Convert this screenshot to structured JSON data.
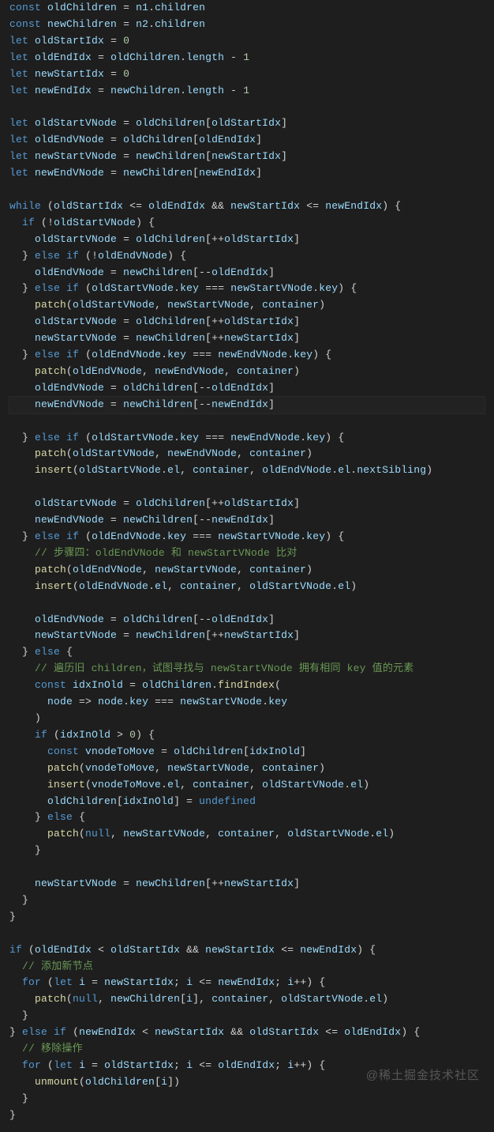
{
  "watermark": "@稀土掘金技术社区",
  "tokens": {
    "kw_const": "const",
    "kw_let": "let",
    "kw_while": "while",
    "kw_if": "if",
    "kw_else": "else",
    "kw_for": "for",
    "kw_null": "null",
    "kw_undefined": "undefined"
  },
  "code_model": {
    "description": "double-ended diff algorithm (Vue-style)",
    "identifiers": [
      "oldChildren",
      "newChildren",
      "oldStartIdx",
      "oldEndIdx",
      "newStartIdx",
      "newEndIdx",
      "oldStartVNode",
      "oldEndVNode",
      "newStartVNode",
      "newEndVNode",
      "n1",
      "n2",
      "children",
      "length",
      "key",
      "el",
      "nextSibling",
      "patch",
      "insert",
      "unmount",
      "container",
      "idxInOld",
      "vnodeToMove",
      "findIndex",
      "node",
      "i"
    ],
    "numeric_literals": [
      0,
      1
    ],
    "comments": [
      "// 步骤四：oldEndVNode 和 newStartVNode 比对",
      "// 遍历旧 children，试图寻找与 newStartVNode 拥有相同 key 值的元素",
      "// 添加新节点",
      "// 移除操作"
    ]
  },
  "chart_data": null,
  "code_lines": [
    "const oldChildren = n1.children",
    "const newChildren = n2.children",
    "let oldStartIdx = 0",
    "let oldEndIdx = oldChildren.length - 1",
    "let newStartIdx = 0",
    "let newEndIdx = newChildren.length - 1",
    "",
    "let oldStartVNode = oldChildren[oldStartIdx]",
    "let oldEndVNode = oldChildren[oldEndIdx]",
    "let newStartVNode = newChildren[newStartIdx]",
    "let newEndVNode = newChildren[newEndIdx]",
    "",
    "while (oldStartIdx <= oldEndIdx && newStartIdx <= newEndIdx) {",
    "  if (!oldStartVNode) {",
    "    oldStartVNode = oldChildren[++oldStartIdx]",
    "  } else if (!oldEndVNode) {",
    "    oldEndVNode = newChildren[--oldEndIdx]",
    "  } else if (oldStartVNode.key === newStartVNode.key) {",
    "    patch(oldStartVNode, newStartVNode, container)",
    "    oldStartVNode = oldChildren[++oldStartIdx]",
    "    newStartVNode = newChildren[++newStartIdx]",
    "  } else if (oldEndVNode.key === newEndVNode.key) {",
    "    patch(oldEndVNode, newEndVNode, container)",
    "    oldEndVNode = oldChildren[--oldEndIdx]",
    "    newEndVNode = newChildren[--newEndIdx]",
    "  } else if (oldStartVNode.key === newEndVNode.key) {",
    "    patch(oldStartVNode, newEndVNode, container)",
    "    insert(oldStartVNode.el, container, oldEndVNode.el.nextSibling)",
    "",
    "    oldStartVNode = oldChildren[++oldStartIdx]",
    "    newEndVNode = newChildren[--newEndIdx]",
    "  } else if (oldEndVNode.key === newStartVNode.key) {",
    "    // 步骤四：oldEndVNode 和 newStartVNode 比对",
    "    patch(oldEndVNode, newStartVNode, container)",
    "    insert(oldEndVNode.el, container, oldStartVNode.el)",
    "",
    "    oldEndVNode = oldChildren[--oldEndIdx]",
    "    newStartVNode = newChildren[++newStartIdx]",
    "  } else {",
    "    // 遍历旧 children，试图寻找与 newStartVNode 拥有相同 key 值的元素",
    "    const idxInOld = oldChildren.findIndex(",
    "      node => node.key === newStartVNode.key",
    "    )",
    "    if (idxInOld > 0) {",
    "      const vnodeToMove = oldChildren[idxInOld]",
    "      patch(vnodeToMove, newStartVNode, container)",
    "      insert(vnodeToMove.el, container, oldStartVNode.el)",
    "      oldChildren[idxInOld] = undefined",
    "    } else {",
    "      patch(null, newStartVNode, container, oldStartVNode.el)",
    "    }",
    "",
    "    newStartVNode = newChildren[++newStartIdx]",
    "  }",
    "}",
    "",
    "if (oldEndIdx < oldStartIdx && newStartIdx <= newEndIdx) {",
    "  // 添加新节点",
    "  for (let i = newStartIdx; i <= newEndIdx; i++) {",
    "    patch(null, newChildren[i], container, oldStartVNode.el)",
    "  }",
    "} else if (newEndIdx < newStartIdx && oldStartIdx <= oldEndIdx) {",
    "  // 移除操作",
    "  for (let i = oldStartIdx; i <= oldEndIdx; i++) {",
    "    unmount(oldChildren[i])",
    "  }",
    "}"
  ]
}
